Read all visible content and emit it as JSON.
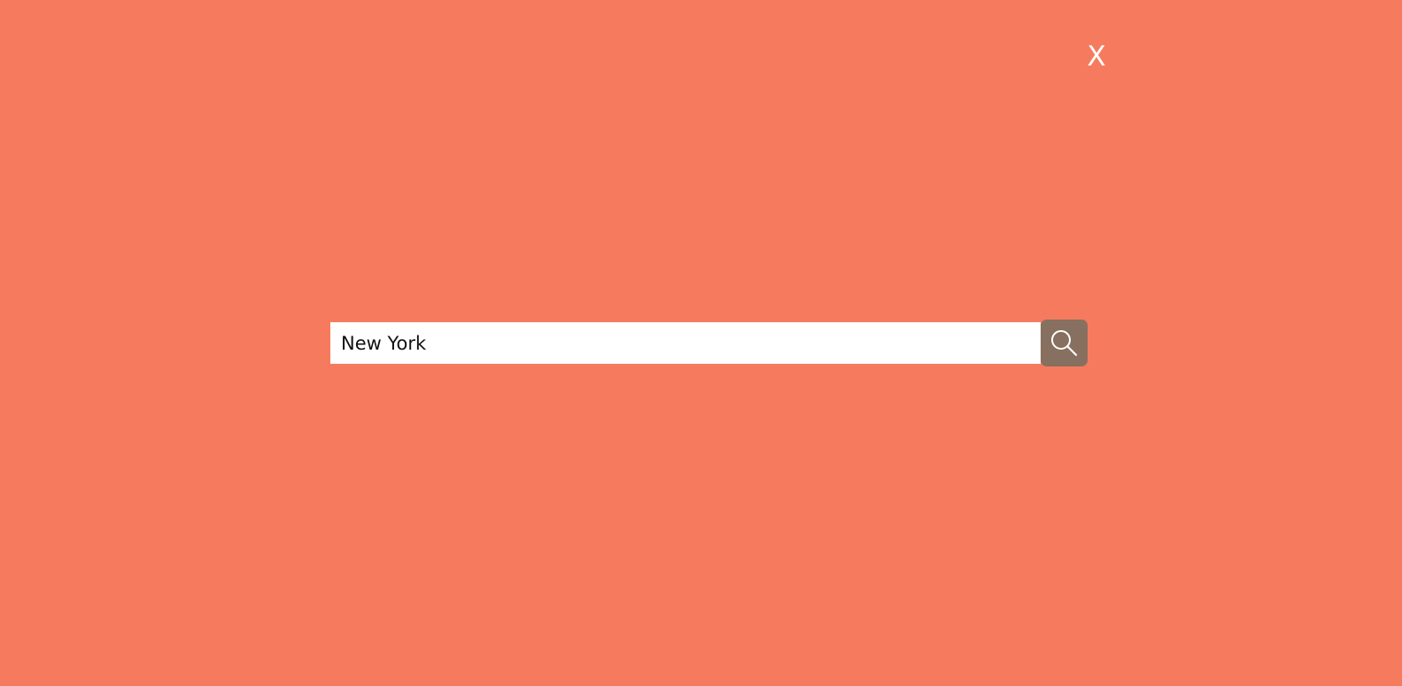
{
  "overlay": {
    "background_color": "#F67B5E"
  },
  "close": {
    "label": "X",
    "icon": "close-icon"
  },
  "search": {
    "value": "New York",
    "button_icon": "search-icon",
    "button_color": "#87705F"
  }
}
